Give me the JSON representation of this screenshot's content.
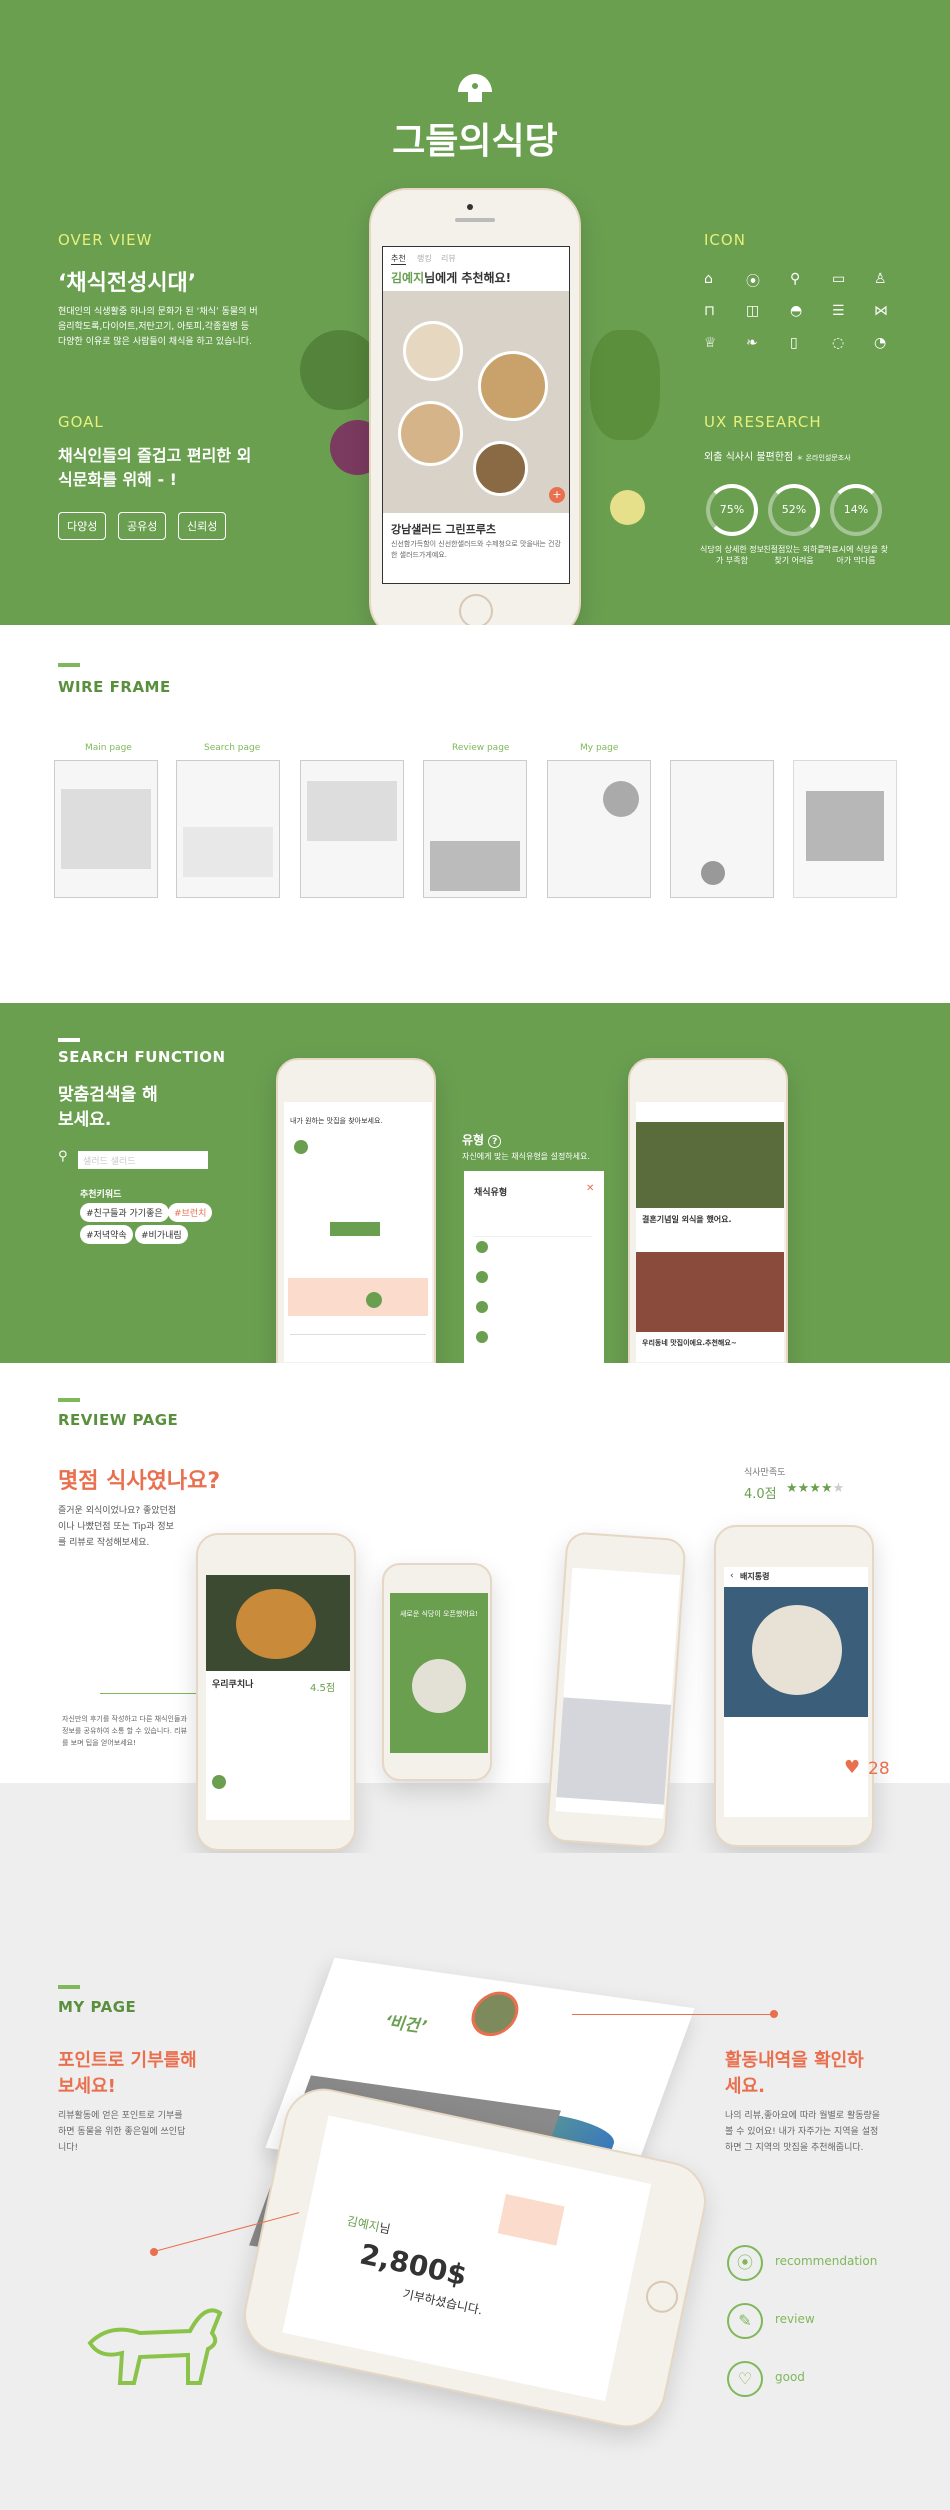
{
  "header": {
    "brand": "그들의식당"
  },
  "overview": {
    "heading": "OVER VIEW",
    "title": "‘채식전성시대’",
    "body": "현대인의 식생활중 하나의 문화가 된 ‘채식’ 동물의 버음리학도록,다이어트,저탄고기, 아토피,각종질병 등 다양한 이유로 많은 사람들이 채식을 하고 있습니다."
  },
  "goal": {
    "heading": "GOAL",
    "title": "채식인들의 즐겁고 편리한 외식문화를 위해 - !",
    "pills": [
      "다양성",
      "공유성",
      "신뢰성"
    ]
  },
  "hero_phone": {
    "tabs": [
      "추천",
      "랭킹",
      "리뷰"
    ],
    "greeting_name": "김예지",
    "greeting_rest": "님에게 추천해요!",
    "place": "강남샐러드 그린프루츠",
    "desc": "신선함가득함이 신선한샐러드와 수제청으로 맛을내는 건강한 샐러드가게예요."
  },
  "icon_section": {
    "heading": "ICON"
  },
  "ux": {
    "heading": "UX RESEARCH",
    "subtitle": "외출 식사시 불편한점",
    "subnote": "＊ 온라인설문조사",
    "stats": [
      {
        "value": "75%",
        "caption": "식당의 상세한 정보가 부족함"
      },
      {
        "value": "52%",
        "caption": "친절점있는 외하를 찾기 어려움"
      },
      {
        "value": "14%",
        "caption": "막료시에 식당을 찾아가 막다름"
      }
    ]
  },
  "wireframe": {
    "heading": "WIRE FRAME",
    "labels": [
      "Main page",
      "Search page",
      "Review page",
      "My page"
    ]
  },
  "search": {
    "heading": "SEARCH FUNCTION",
    "title": "맞춤검색을 해보세요.",
    "input_placeholder": "샐러드 샐러드",
    "keywords_title": "추천키워드",
    "keywords": [
      "#친구들과 가기좋은",
      "#브런치",
      "#저녁약속",
      "#비가내림"
    ],
    "type_label": "유형",
    "type_desc": "자신에게 맞는 채식유형을 설정하세요.",
    "popup_title": "채식유형",
    "phone_left_title": "내가 원하는 맛집을 찾아보세요.",
    "phone_right_title": "결혼기념일 외식을 했어요.",
    "phone_right_title2": "우리동네 맛집이에요.추천해요~"
  },
  "review": {
    "heading": "REVIEW PAGE",
    "title": "몇점 식사였나요?",
    "body": "즐거운 외식이었나요? 좋았던점이나 나빴던점 또는 Tip과 정보를 리뷰로 작성해보세요.",
    "side_note": "자신만의 후기를 작성하고 다른 채식인들과 정보를 공유하여 소통 할 수 있습니다. 리뷰를 보며 팁을 얻어보세요!",
    "rating_label": "식사만족도",
    "rating_value": "4.0점",
    "phone1_place": "우리쿠치나",
    "phone1_score": "4.5점",
    "phone2_text": "새로운 식당이 오픈했어요!",
    "phone4_title": "배지통령",
    "likes": "28"
  },
  "mypage": {
    "heading": "MY PAGE",
    "left_title": "포인트로 기부를해보세요!",
    "left_body": "리뷰활동에 얻은 포인트로 기부를 하면 동물을 위한 좋은일에 쓰인답니다!",
    "right_title": "활동내역을 확인하세요.",
    "right_body": "나의 리뷰,좋아요에 따라 월별로 활동량을 볼 수 있어요! 내가 자주가는 지역을 설정하면 그 지역의 맛집을 추천해줍니다.",
    "name_tag": "‘비건’",
    "phone_name": "김예지",
    "phone_name_suffix": "님",
    "points": "2,800$",
    "points_caption": "기부하셨습니다.",
    "legend": [
      {
        "icon": "pin-icon",
        "label": "recommendation"
      },
      {
        "icon": "pencil-icon",
        "label": "review"
      },
      {
        "icon": "heart-icon",
        "label": "good"
      }
    ]
  },
  "colors": {
    "green": "#6a9f50",
    "accent": "#e9704f",
    "light_green": "#7fb85a"
  }
}
